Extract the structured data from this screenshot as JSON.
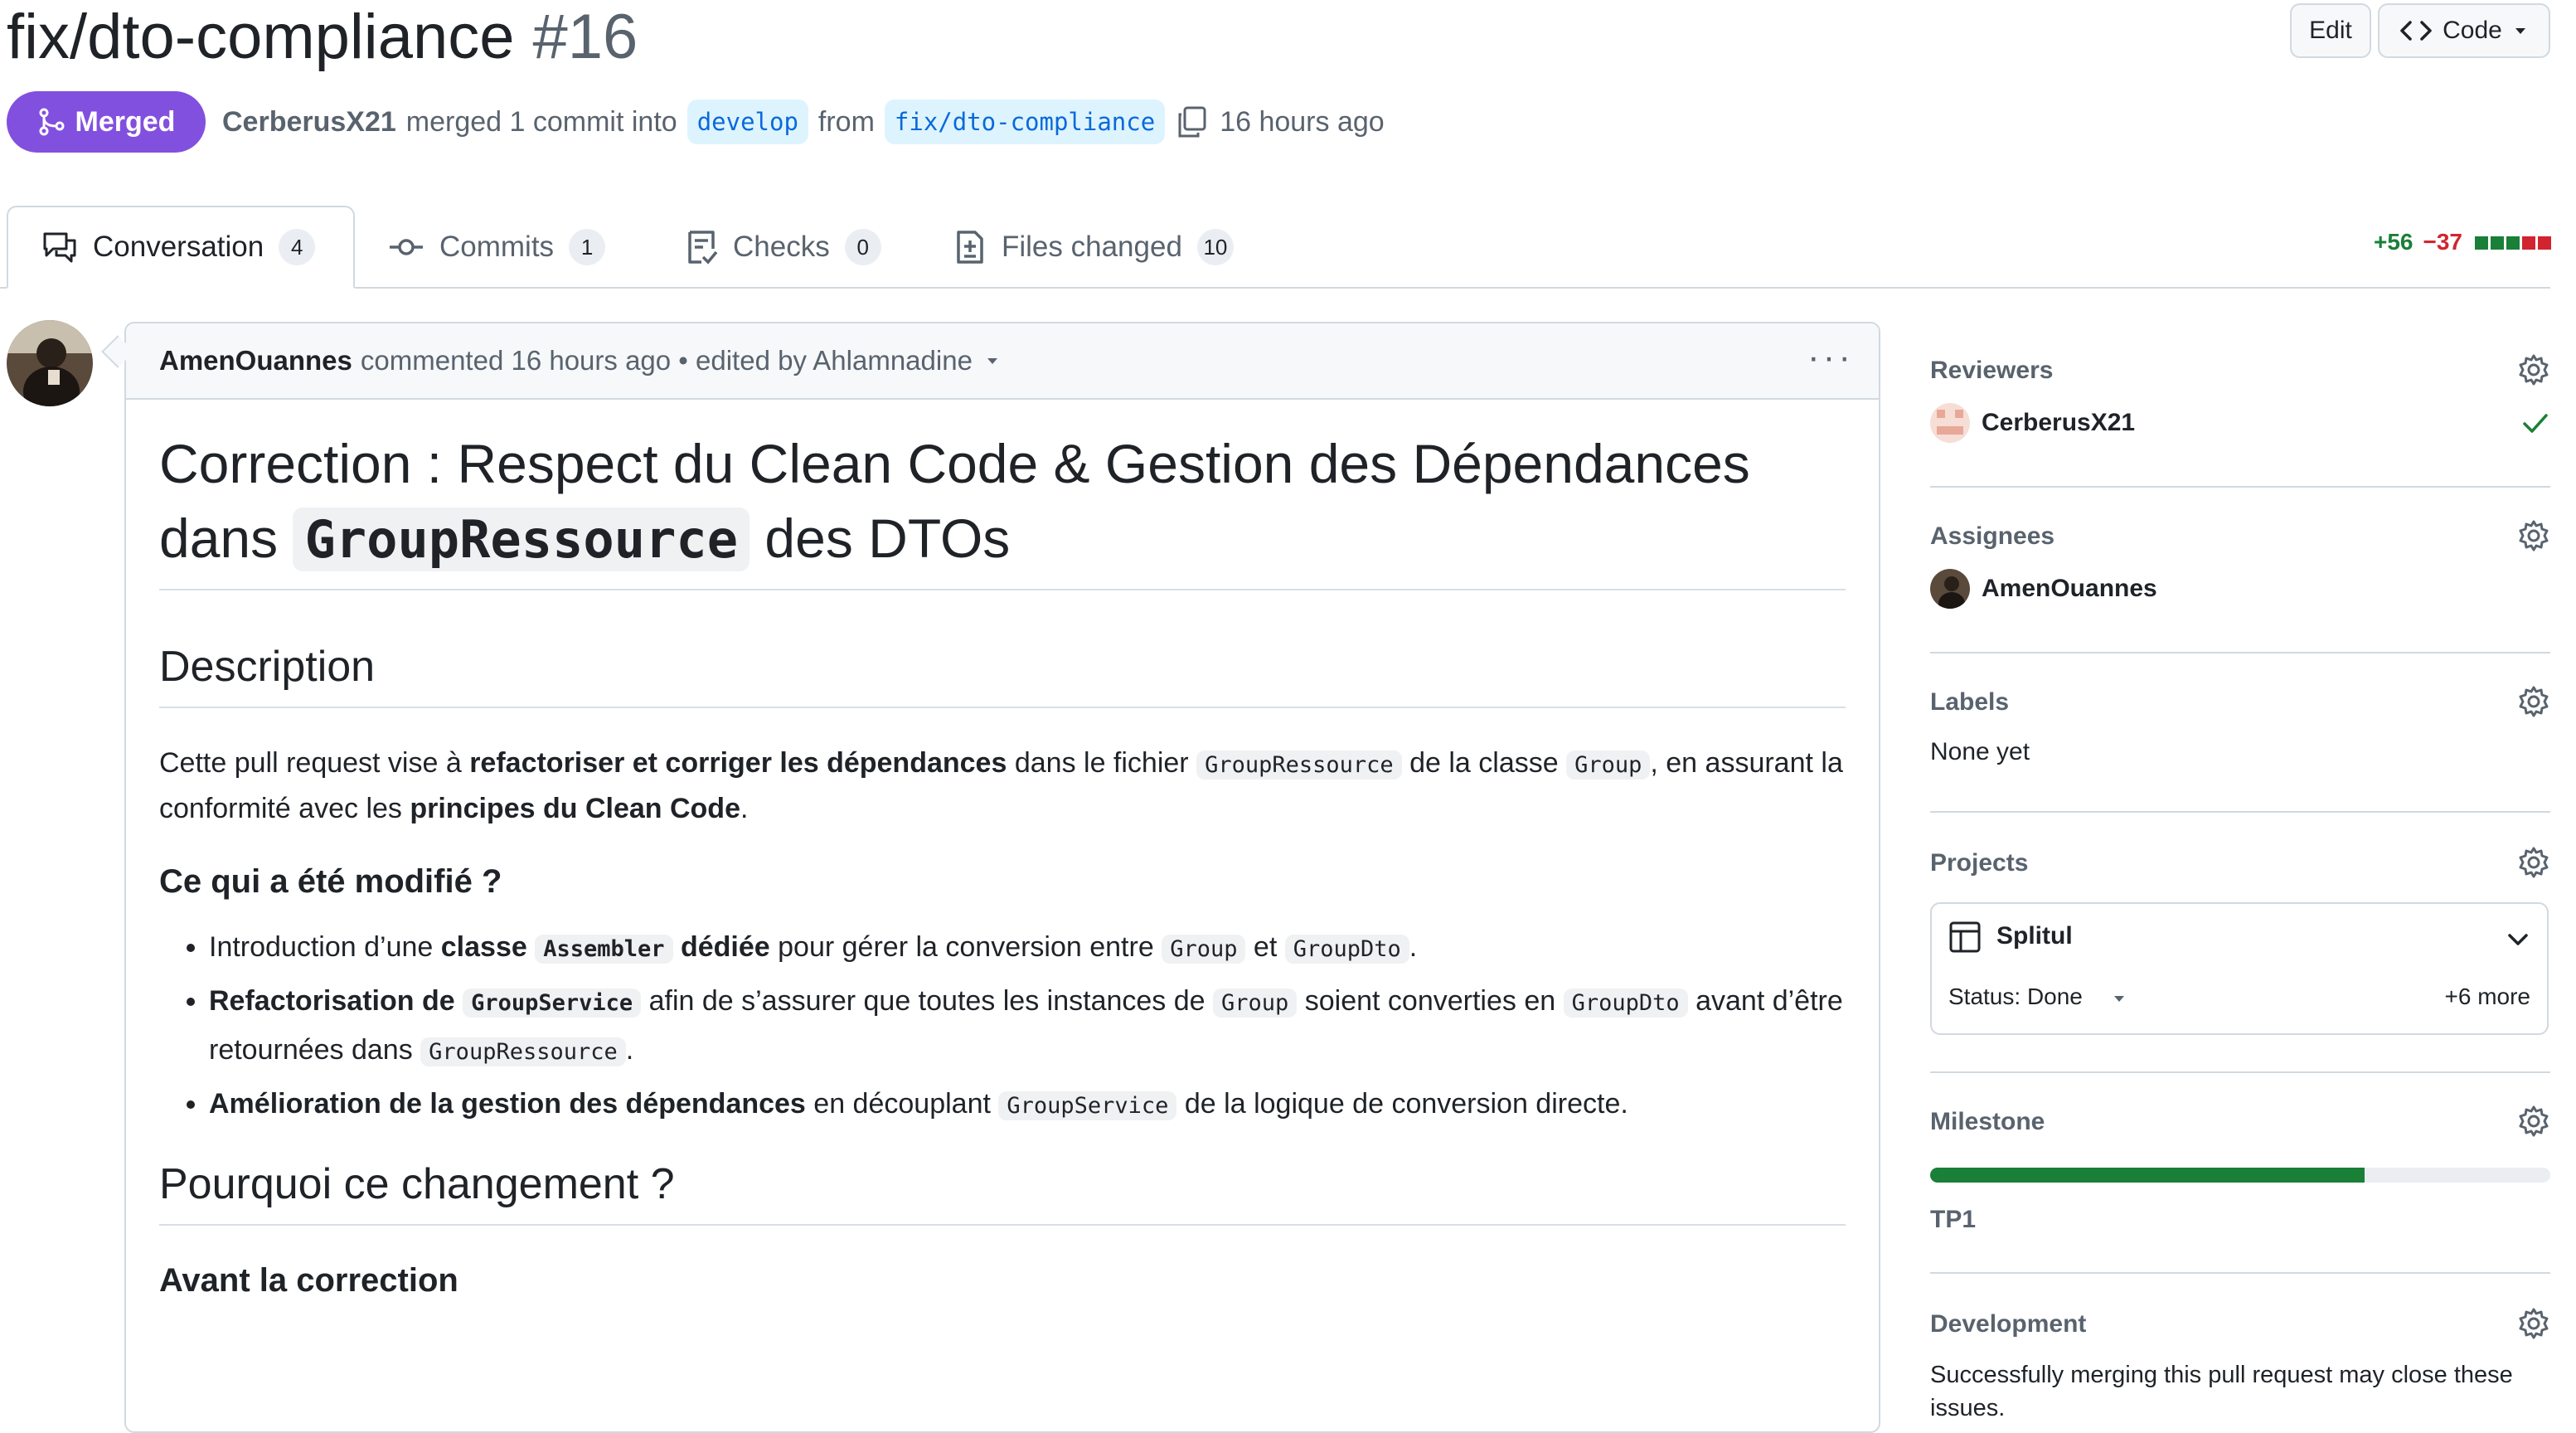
{
  "header": {
    "title": "fix/dto-compliance",
    "number": "#16",
    "edit_label": "Edit",
    "code_label": "Code",
    "state_label": "Merged",
    "author": "CerberusX21",
    "merged_text": "merged 1 commit into",
    "base_branch": "develop",
    "from_text": "from",
    "head_branch": "fix/dto-compliance",
    "time": "16 hours ago"
  },
  "tabs": [
    {
      "label": "Conversation",
      "count": "4",
      "icon": "conversation-icon"
    },
    {
      "label": "Commits",
      "count": "1",
      "icon": "commit-icon"
    },
    {
      "label": "Checks",
      "count": "0",
      "icon": "checklist-icon"
    },
    {
      "label": "Files changed",
      "count": "10",
      "icon": "file-diff-icon"
    }
  ],
  "diffstat": {
    "additions": "+56",
    "deletions": "−37"
  },
  "comment": {
    "author": "AmenOuannes",
    "meta": "commented 16 hours ago • edited by Ahlamnadine",
    "title_part1": "Correction : Respect du Clean Code & Gestion des Dépendances dans",
    "title_code": "GroupRessource",
    "title_part2": "des DTOs",
    "h_description": "Description",
    "desc": {
      "t1": "Cette pull request vise à ",
      "b1": "refactoriser et corriger les dépendances",
      "t2": " dans le fichier ",
      "c1": "GroupRessource",
      "t3": " de la classe ",
      "c2": "Group",
      "t4": ", en assurant la conformité avec les ",
      "b2": "principes du Clean Code",
      "t5": "."
    },
    "h_modified": "Ce qui a été modifié ?",
    "items": [
      {
        "t1": "Introduction d’une ",
        "b1": "classe",
        "c1": "Assembler",
        "b2": "dédiée",
        "t2": " pour gérer la conversion entre ",
        "c2": "Group",
        "t3": " et ",
        "c3": "GroupDto",
        "t4": "."
      },
      {
        "b1": "Refactorisation de",
        "c1": "GroupService",
        "t1": " afin de s’assurer que toutes les instances de ",
        "c2": "Group",
        "t2": " soient converties en ",
        "c3": "GroupDto",
        "t3": " avant d’être retournées dans ",
        "c4": "GroupRessource",
        "t4": "."
      },
      {
        "b1": "Amélioration de la gestion des dépendances",
        "t1": " en découplant ",
        "c1": "GroupService",
        "t2": " de la logique de conversion directe."
      }
    ],
    "h_why": "Pourquoi ce changement ?",
    "h_before": "Avant la correction"
  },
  "sidebar": {
    "reviewers_title": "Reviewers",
    "reviewer": "CerberusX21",
    "assignees_title": "Assignees",
    "assignee": "AmenOuannes",
    "labels_title": "Labels",
    "labels_value": "None yet",
    "projects_title": "Projects",
    "project_name": "Splitul",
    "project_status": "Status: Done",
    "project_more": "+6 more",
    "milestone_title": "Milestone",
    "milestone_name": "TP1",
    "milestone_progress": 0.7,
    "development_title": "Development",
    "development_text": "Successfully merging this pull request may close these issues."
  },
  "colors": {
    "merged": "#8250df",
    "link": "#0969da",
    "success": "#1a7f37",
    "danger": "#d1242f"
  }
}
